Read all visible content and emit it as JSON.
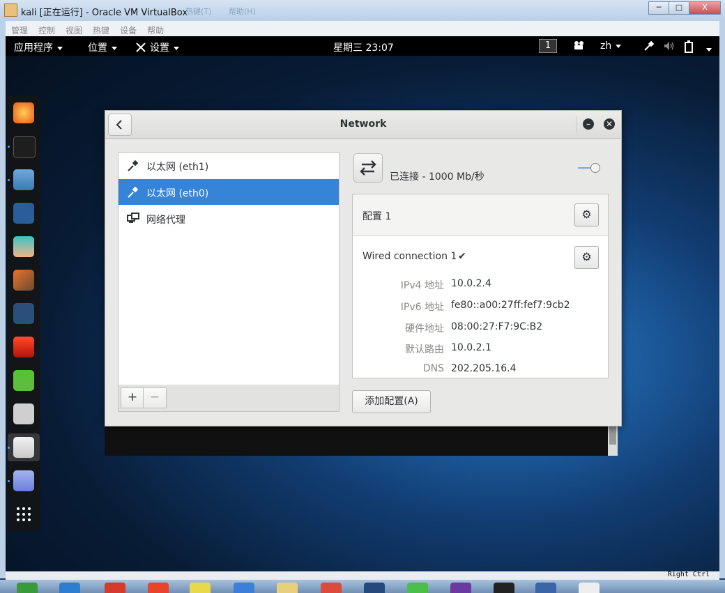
{
  "vbox": {
    "title": "kali [正在运行] - Oracle VM VirtualBox",
    "ghost_menu": [
      "热键(T)",
      "帮助(H)"
    ],
    "window_buttons": {
      "minimize": "─",
      "maximize": "□",
      "close": "X"
    },
    "menu": [
      "管理",
      "控制",
      "视图",
      "热键",
      "设备",
      "帮助"
    ],
    "status_right": "Right Ctrl"
  },
  "topbar": {
    "apps": "应用程序",
    "places": "位置",
    "settings": "设置",
    "clock": "星期三 23:07",
    "workspace": "1",
    "lang": "zh"
  },
  "dock": {
    "items": [
      "firefox-icon",
      "terminal-icon",
      "files-icon",
      "metasploit-icon",
      "avatar-app-icon",
      "burpsuite-icon",
      "maltego-icon",
      "faraday-icon",
      "text-editor-icon",
      "keyboard-icon",
      "tweaks-icon",
      "notes-icon",
      "app-grid-icon"
    ]
  },
  "window": {
    "title": "Network",
    "back_icon": "chevron-left-icon",
    "minimize_label": "–",
    "close_label": "✕"
  },
  "sidebar": {
    "items": [
      {
        "label": "以太网 (eth1)",
        "icon": "ethernet-icon",
        "selected": false
      },
      {
        "label": "以太网 (eth0)",
        "icon": "ethernet-icon",
        "selected": true
      },
      {
        "label": "网络代理",
        "icon": "proxy-icon",
        "selected": false
      }
    ],
    "add_label": "+",
    "remove_label": "−"
  },
  "device": {
    "status": "已连接 - 1000 Mb/秒",
    "switch_on": true
  },
  "profiles": {
    "profile_title": "配置 1",
    "connection_title": "Wired connection 1",
    "check_mark": "✔",
    "gear_label": "⚙",
    "details": [
      {
        "key": "IPv4 地址",
        "value": "10.0.2.4"
      },
      {
        "key": "IPv6 地址",
        "value": "fe80::a00:27ff:fef7:9cb2"
      },
      {
        "key": "硬件地址",
        "value": "08:00:27:F7:9C:B2"
      },
      {
        "key": "默认路由",
        "value": "10.0.2.1"
      },
      {
        "key": "DNS",
        "value": "202.205.16.4"
      }
    ]
  },
  "add_profile_label": "添加配置(A)",
  "colors": {
    "selection": "#3584d8",
    "topbar": "#000000",
    "accent": "#7aa7d6"
  }
}
